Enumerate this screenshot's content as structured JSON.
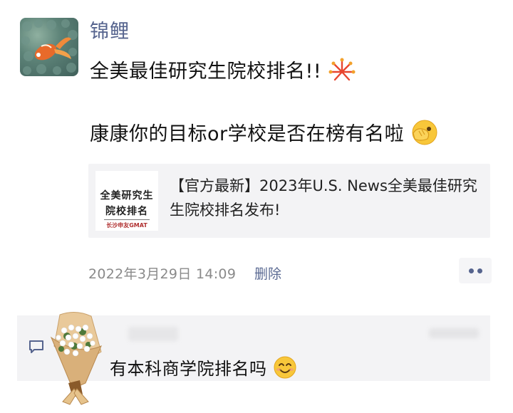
{
  "post": {
    "username": "锦鲤",
    "text_line1": "全美最佳研究生院校排名!!",
    "text_line1_emoji": "fireworks-emoji",
    "text_line2": "康康你的目标or学校是否在榜有名啦",
    "text_line2_emoji": "peeking-face-emoji",
    "link_card": {
      "thumbnail_line1": "全美研究生",
      "thumbnail_line2": "院校排名",
      "thumbnail_caption": "长沙申友GMAT",
      "title": "【官方最新】2023年U.S. News全美最佳研究生院校排名发布!"
    },
    "timestamp": "2022年3月29日 14:09",
    "delete_label": "删除"
  },
  "comment": {
    "text": "有本科商学院排名吗",
    "emoji": "smiling-face-emoji"
  },
  "colors": {
    "link_blue": "#56648e",
    "card_bg": "#f3f3f5",
    "muted_text": "#8a8a8a"
  }
}
